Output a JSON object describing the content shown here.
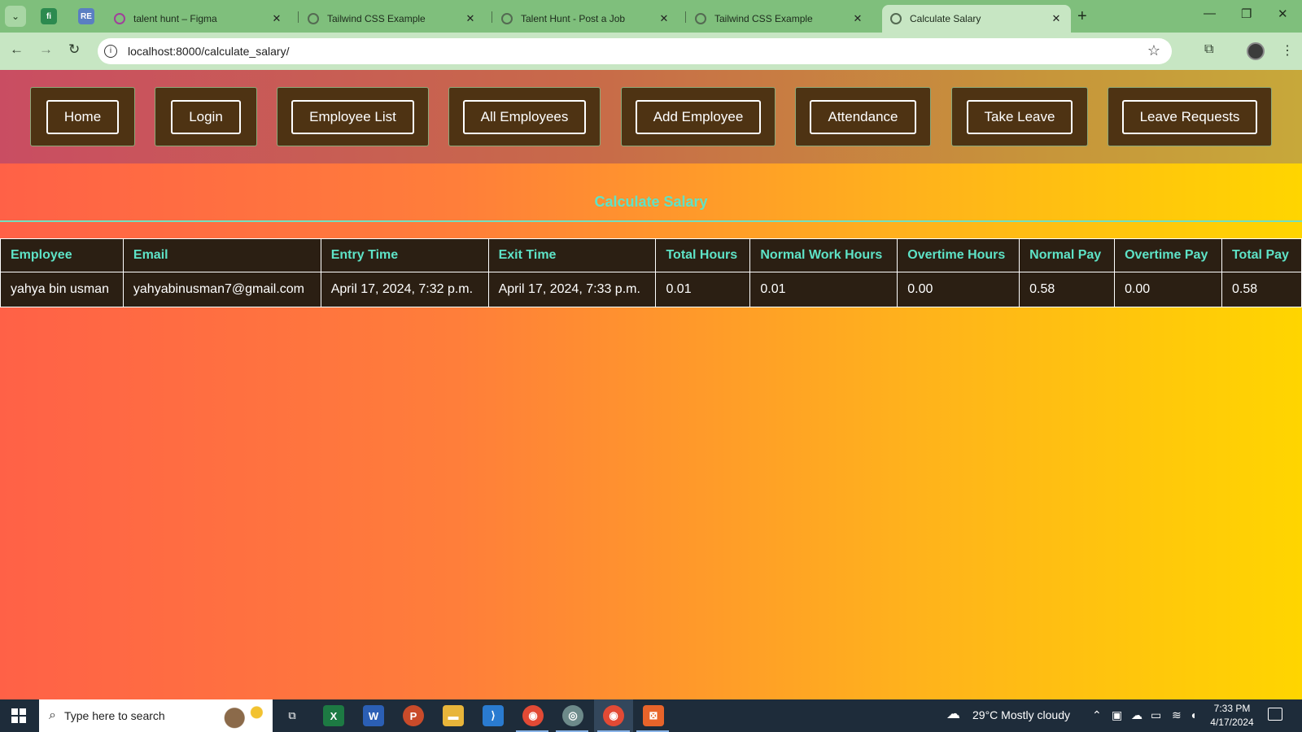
{
  "browser": {
    "tabs": [
      {
        "title": "talent hunt – Figma",
        "active": false
      },
      {
        "title": "Tailwind CSS Example",
        "active": false
      },
      {
        "title": "Talent Hunt - Post a Job",
        "active": false
      },
      {
        "title": "Tailwind CSS Example",
        "active": false
      },
      {
        "title": "Calculate Salary",
        "active": true
      }
    ],
    "url": "localhost:8000/calculate_salary/"
  },
  "nav": {
    "items": [
      "Home",
      "Login",
      "Employee List",
      "All Employees",
      "Add Employee",
      "Attendance",
      "Take Leave",
      "Leave Requests"
    ]
  },
  "page": {
    "title": "Calculate Salary"
  },
  "table": {
    "headers": [
      "Employee",
      "Email",
      "Entry Time",
      "Exit Time",
      "Total Hours",
      "Normal Work Hours",
      "Overtime Hours",
      "Normal Pay",
      "Overtime Pay",
      "Total Pay"
    ],
    "rows": [
      [
        "yahya bin usman",
        "yahyabinusman7@gmail.com",
        "April 17, 2024, 7:32 p.m.",
        "April 17, 2024, 7:33 p.m.",
        "0.01",
        "0.01",
        "0.00",
        "0.58",
        "0.00",
        "0.58"
      ]
    ]
  },
  "taskbar": {
    "search_placeholder": "Type here to search",
    "weather": "29°C  Mostly cloudy",
    "time": "7:33 PM",
    "date": "4/17/2024"
  },
  "colors": {
    "accent": "#5ee3c7",
    "card": "#4e3313",
    "table_bg": "#2b1f13"
  }
}
